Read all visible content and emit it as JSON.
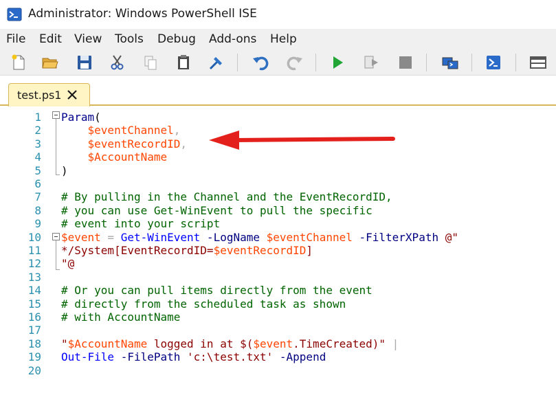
{
  "window": {
    "title": "Administrator: Windows PowerShell ISE"
  },
  "menu": [
    "File",
    "Edit",
    "View",
    "Tools",
    "Debug",
    "Add-ons",
    "Help"
  ],
  "toolbar": [
    "new-script-icon",
    "open-folder-icon",
    "save-icon",
    "cut-icon",
    "copy-icon",
    "paste-icon",
    "clear-console-icon",
    "undo-icon",
    "redo-icon",
    "run-script-icon",
    "run-selection-icon",
    "stop-icon",
    "remote-powershell-icon",
    "powershell-console-icon",
    "layout-pane-icon"
  ],
  "tab": {
    "label": "test.ps1"
  },
  "editor": {
    "line_numbers": [
      "1",
      "2",
      "3",
      "4",
      "5",
      "6",
      "7",
      "8",
      "9",
      "10",
      "11",
      "12",
      "13",
      "14",
      "15",
      "16",
      "17",
      "18",
      "19",
      "20"
    ],
    "lines": [
      [
        {
          "t": "Param",
          "c": "c-kw"
        },
        {
          "t": "(",
          "c": "c-punct"
        }
      ],
      [
        {
          "t": "    ",
          "c": "c-punct"
        },
        {
          "t": "$eventChannel",
          "c": "c-var"
        },
        {
          "t": ",",
          "c": "c-op"
        }
      ],
      [
        {
          "t": "    ",
          "c": "c-punct"
        },
        {
          "t": "$eventRecordID",
          "c": "c-var"
        },
        {
          "t": ",",
          "c": "c-op"
        }
      ],
      [
        {
          "t": "    ",
          "c": "c-punct"
        },
        {
          "t": "$AccountName",
          "c": "c-var"
        }
      ],
      [
        {
          "t": ")",
          "c": "c-punct"
        }
      ],
      [],
      [
        {
          "t": "# By pulling in the Channel and the EventRecordID,",
          "c": "c-comment"
        }
      ],
      [
        {
          "t": "# you can use Get-WinEvent to pull the specific",
          "c": "c-comment"
        }
      ],
      [
        {
          "t": "# event into your script",
          "c": "c-comment"
        }
      ],
      [
        {
          "t": "$event",
          "c": "c-var"
        },
        {
          "t": " = ",
          "c": "c-op"
        },
        {
          "t": "Get-WinEvent",
          "c": "c-cmd"
        },
        {
          "t": " -LogName ",
          "c": "c-param"
        },
        {
          "t": "$eventChannel",
          "c": "c-var"
        },
        {
          "t": " -FilterXPath ",
          "c": "c-param"
        },
        {
          "t": "@\"",
          "c": "c-str"
        }
      ],
      [
        {
          "t": "*/System[EventRecordID=",
          "c": "c-str"
        },
        {
          "t": "$eventRecordID",
          "c": "c-var"
        },
        {
          "t": "]",
          "c": "c-str"
        }
      ],
      [
        {
          "t": "\"@",
          "c": "c-str"
        }
      ],
      [],
      [
        {
          "t": "# Or you can pull items directly from the event",
          "c": "c-comment"
        }
      ],
      [
        {
          "t": "# directly from the scheduled task as shown",
          "c": "c-comment"
        }
      ],
      [
        {
          "t": "# with AccountName",
          "c": "c-comment"
        }
      ],
      [],
      [
        {
          "t": "\"",
          "c": "c-str"
        },
        {
          "t": "$AccountName",
          "c": "c-var"
        },
        {
          "t": " logged in at $(",
          "c": "c-str"
        },
        {
          "t": "$event",
          "c": "c-var"
        },
        {
          "t": ".TimeCreated)\"",
          "c": "c-str"
        },
        {
          "t": " |",
          "c": "c-op"
        }
      ],
      [
        {
          "t": "Out-File",
          "c": "c-cmd"
        },
        {
          "t": " -FilePath ",
          "c": "c-param"
        },
        {
          "t": "'c:\\test.txt'",
          "c": "c-str"
        },
        {
          "t": " -Append",
          "c": "c-param"
        }
      ],
      []
    ]
  },
  "colors": {
    "accent_tab": "#fff4c4",
    "arrow": "#e3201b",
    "line_number": "#2b91af"
  }
}
